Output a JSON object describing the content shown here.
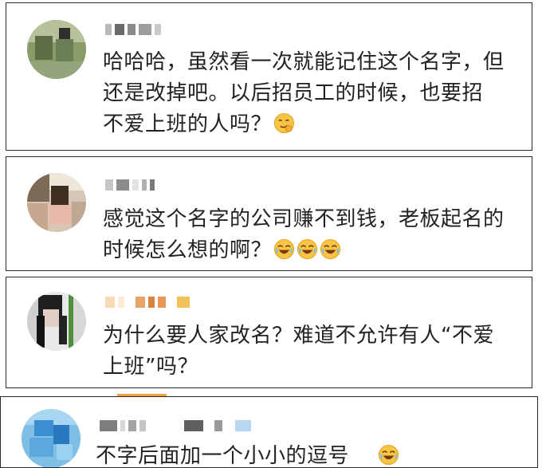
{
  "comments": [
    {
      "lines": [
        "哈哈哈，虽然看一次就能记住这个名字，但",
        "还是改掉吧。以后招员工的时候，也要招",
        "不爱上班的人吗？"
      ],
      "emojis": [
        "smirk-thinking"
      ]
    },
    {
      "lines": [
        "感觉这个名字的公司赚不到钱，老板起名的",
        "时候怎么想的啊？"
      ],
      "emojis": [
        "laugh-cry",
        "laugh-cry",
        "laugh-cry"
      ]
    },
    {
      "lines": [
        "为什么要人家改名？难道不允许有人“不爱",
        "上班”吗？"
      ],
      "emojis": []
    },
    {
      "lines": [
        "不字后面加一个小小的逗号"
      ],
      "emojis": [
        "laugh-cry"
      ]
    }
  ],
  "colors": {
    "border": "#2a2a2a",
    "text": "#222222",
    "accent_tab": "#f0a040"
  },
  "icons": [
    "avatar",
    "smirk-thinking-emoji",
    "laugh-cry-emoji"
  ]
}
